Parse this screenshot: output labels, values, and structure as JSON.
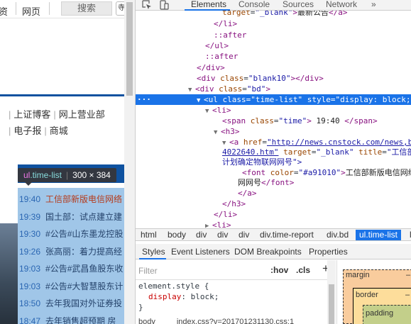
{
  "page": {
    "topbar": {
      "item1": "资",
      "item2": "网页",
      "search_button": "搜索",
      "edge_button": "寺"
    },
    "quick_links": {
      "row1": [
        "上证博客",
        "网上营业部"
      ],
      "row2": [
        "电子报",
        "商城"
      ]
    },
    "tooltip": {
      "tag": "ul",
      "class": ".time-list",
      "size": "300 × 384"
    },
    "news": [
      {
        "time": "19:40",
        "title": "工信部新版电信网络"
      },
      {
        "time": "19:39",
        "title": "国土部：试点建立建"
      },
      {
        "time": "19:30",
        "title": "#公告#山东墨龙控股"
      },
      {
        "time": "19:26",
        "title": "张高丽：着力提高经"
      },
      {
        "time": "19:03",
        "title": "#公告#武昌鱼股东收"
      },
      {
        "time": "19:03",
        "title": "#公告#大智慧股东计"
      },
      {
        "time": "18:50",
        "title": "去年我国对外证券投"
      },
      {
        "time": "18:47",
        "title": "去年销售超预期 房"
      }
    ]
  },
  "devtools": {
    "tabs": [
      "Elements",
      "Console",
      "Sources",
      "Network"
    ],
    "more_tabs": "»",
    "dom": {
      "l1_attr": "target",
      "l1_val": "\"_blank\"",
      "l1_text": "最新公告",
      "li_close": "</li>",
      "after": "::after",
      "ul_close": "</ul>",
      "div_close": "</div>",
      "blank_div_open": "<div",
      "blank_class_attr": "class",
      "blank_class_val": "\"blank10\"",
      "blank_div_close": "></div>",
      "bd_open": "<div",
      "bd_class_attr": "class",
      "bd_class_val": "\"bd\"",
      "bd_gt": ">",
      "ul_open": "<ul",
      "ul_class_attr": "class",
      "ul_class_val": "\"time-list\"",
      "ul_style_attr": "style",
      "ul_style_val": "\"display: block;",
      "li_open": "<li>",
      "span_open": "<span",
      "span_class_attr": "class",
      "span_class_val": "\"time\"",
      "span_time": "19:40",
      "span_close": "</span>",
      "h3_open": "<h3>",
      "h3_close": "</h3>",
      "a_open": "<a",
      "a_href_attr": "href",
      "a_href_val": "\"http://news.cnstock.com/news,b",
      "a_href_cont": "4022640.htm\"",
      "a_target_attr": "target",
      "a_target_val": "\"_blank\"",
      "a_title_attr": "title",
      "a_title_val": "\"工信部",
      "a_title_cont": "计划确定物联网网号\">",
      "font_open": "<font",
      "font_color_attr": "color",
      "font_color_val": "\"#a91010\"",
      "font_text": "工信部新版电信网络",
      "font_text_cont": "网网号",
      "font_close": "</font>",
      "a_close": "</a>"
    },
    "breadcrumbs": [
      "html",
      "body",
      "div",
      "div",
      "div",
      "div.time-report",
      "div.bd",
      "ul.time-list",
      "li"
    ],
    "subtabs": [
      "Styles",
      "Event Listeners",
      "DOM Breakpoints",
      "Properties"
    ],
    "styles": {
      "filter_placeholder": "Filter",
      "hov": ":hov",
      "cls": ".cls",
      "plus": "+",
      "selector": "element.style {",
      "prop": "display",
      "value": "block;",
      "close_brace": "}",
      "next_rule": "body",
      "next_source": "index.css?v=201701231130.css:1"
    },
    "box_model": {
      "margin": "margin",
      "border": "border",
      "padding": "padding",
      "dash": "–"
    }
  }
}
